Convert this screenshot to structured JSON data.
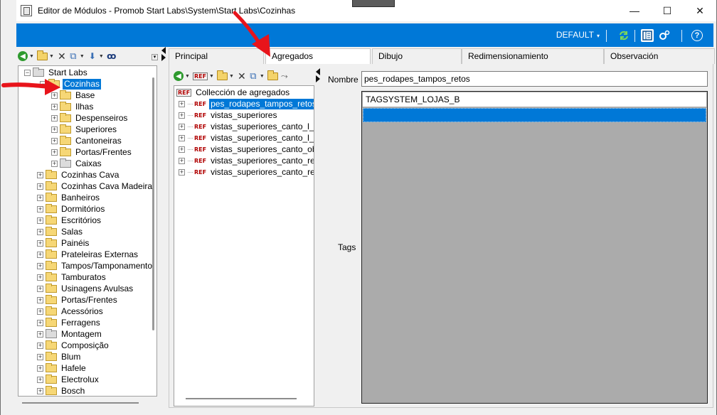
{
  "window": {
    "title": "Editor de Módulos - Promob Start Labs\\System\\Start Labs\\Cozinhas",
    "minimize_glyph": "—",
    "maximize_glyph": "☐",
    "close_glyph": "✕"
  },
  "ribbon": {
    "profile_label": "DEFAULT",
    "profile_caret": "▾",
    "help_glyph": "?",
    "accent_color": "#0078d7"
  },
  "left_toolbar": {
    "icons": [
      "back-icon",
      "new-folder-icon",
      "delete-icon",
      "copy-icon",
      "arrow-down-icon",
      "binoculars-icon"
    ]
  },
  "tree": {
    "root": "Start Labs",
    "selected": "Cozinhas",
    "children_of_selected": [
      "Base",
      "Ilhas",
      "Despenseiros",
      "Superiores",
      "Cantoneiras",
      "Portas/Frentes",
      "Caixas"
    ],
    "siblings": [
      "Cozinhas Cava",
      "Cozinhas Cava Madeira",
      "Banheiros",
      "Dormitórios",
      "Escritórios",
      "Salas",
      "Painéis",
      "Prateleiras Externas",
      "Tampos/Tamponamento",
      "Tamburatos",
      "Usinagens Avulsas",
      "Portas/Frentes",
      "Acessórios",
      "Ferragens",
      "Montagem",
      "Composição",
      "Blum",
      "Hafele",
      "Electrolux",
      "Bosch"
    ]
  },
  "tabs": {
    "principal": "Principal",
    "agregados": "Agregados",
    "dibujo": "Dibujo",
    "redimensionamiento": "Redimensionamiento",
    "observacion": "Observación"
  },
  "agregados": {
    "ref_label": "REF",
    "collection_title": "Collección de agregados",
    "items": [
      "pes_rodapes_tampos_retos",
      "vistas_superiores",
      "vistas_superiores_canto_l_Dir",
      "vistas_superiores_canto_l_Esq",
      "vistas_superiores_canto_obl",
      "vistas_superiores_canto_reto_dir",
      "vistas_superiores_canto_reto_esq"
    ],
    "selected_item": "pes_rodapes_tampos_retos"
  },
  "form": {
    "nombre_label": "Nombre",
    "nombre_value": "pes_rodapes_tampos_retos",
    "tags_label": "Tags",
    "tags": [
      "TAGSYSTEM_LOJAS_B"
    ]
  }
}
